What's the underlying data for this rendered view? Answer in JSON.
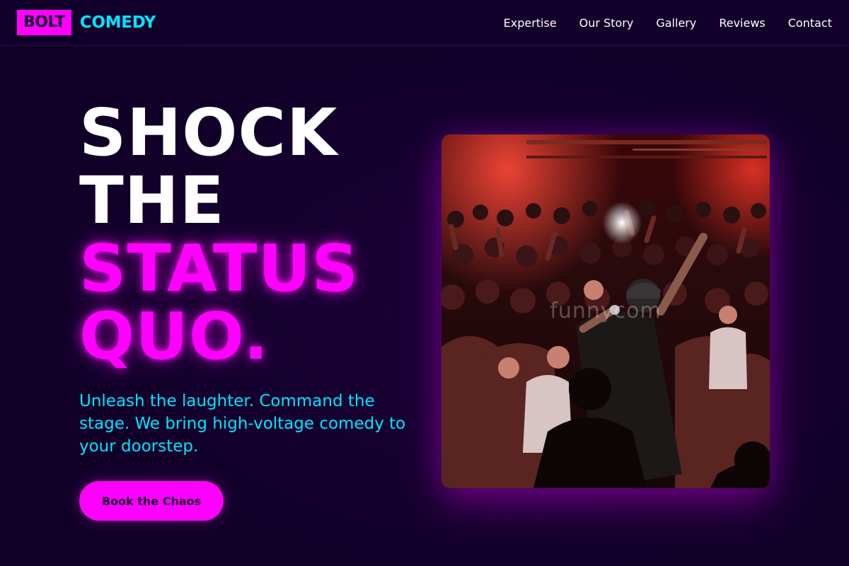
{
  "header": {
    "logo_box": "BOLT",
    "logo_word": "COMEDY",
    "nav": [
      "Expertise",
      "Our Story",
      "Gallery",
      "Reviews",
      "Contact"
    ]
  },
  "hero": {
    "title_line1": "SHOCK",
    "title_line2": "THE",
    "title_line3": "STATUS",
    "title_line4": "QUO.",
    "tagline": "Unleash the laughter. Command the stage. We bring high-voltage comedy to your doorstep.",
    "cta_label": "Book the Chaos",
    "image_watermark": "funnycom"
  },
  "colors": {
    "background": "#12002a",
    "accent_pink": "#ff00ff",
    "accent_cyan": "#00e5ff",
    "text_white": "#ffffff"
  }
}
